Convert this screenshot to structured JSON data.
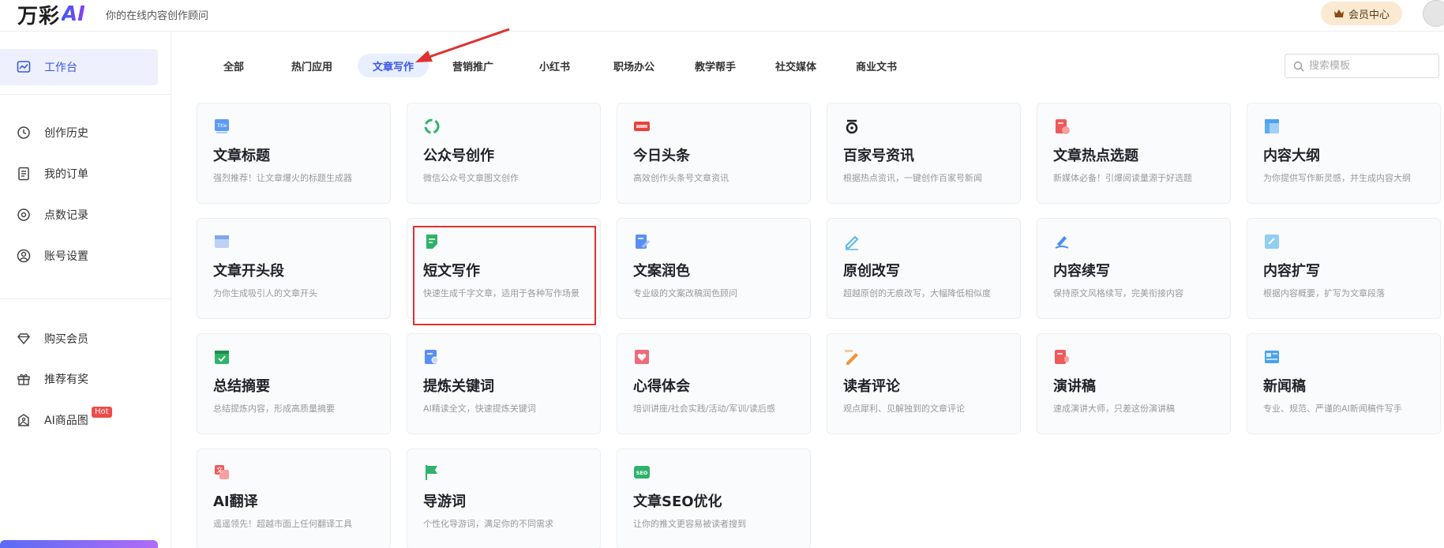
{
  "header": {
    "logo_text": "万彩",
    "logo_ai": "AI",
    "slogan": "你的在线内容创作顾问",
    "vip_label": "会员中心"
  },
  "sidebar": {
    "items": [
      {
        "label": "工作台",
        "icon": "dashboard-icon",
        "active": true
      },
      {
        "label": "创作历史",
        "icon": "history-icon"
      },
      {
        "label": "我的订单",
        "icon": "order-icon"
      },
      {
        "label": "点数记录",
        "icon": "points-icon"
      },
      {
        "label": "账号设置",
        "icon": "user-icon"
      },
      {
        "label": "购买会员",
        "icon": "diamond-icon"
      },
      {
        "label": "推荐有奖",
        "icon": "gift-icon"
      },
      {
        "label": "AI商品图",
        "icon": "image-icon",
        "badge": "Hot"
      }
    ]
  },
  "tabs": [
    "全部",
    "热门应用",
    "文章写作",
    "营销推广",
    "小红书",
    "职场办公",
    "教学帮手",
    "社交媒体",
    "商业文书"
  ],
  "active_tab": "文章写作",
  "search": {
    "placeholder": "搜索模板"
  },
  "cards": [
    {
      "title": "文章标题",
      "desc": "强烈推荐！让文章爆火的标题生成器",
      "icon": "title-icon",
      "color": "#5b9bf5"
    },
    {
      "title": "公众号创作",
      "desc": "微信公众号文章图文创作",
      "icon": "recycle-icon",
      "color": "#2fb36a"
    },
    {
      "title": "今日头条",
      "desc": "高效创作头条号文章资讯",
      "icon": "toutiao-icon",
      "color": "#e8423c"
    },
    {
      "title": "百家号资讯",
      "desc": "根据热点资讯，一键创作百家号新闻",
      "icon": "baijia-icon",
      "color": "#222222"
    },
    {
      "title": "文章热点选题",
      "desc": "新媒体必备！引爆阅读量源于好选题",
      "icon": "hot-topic-icon",
      "color": "#ef5a5a"
    },
    {
      "title": "内容大纲",
      "desc": "为你提供写作新灵感，并生成内容大纲",
      "icon": "outline-icon",
      "color": "#4aa3f0"
    },
    {
      "title": "文章开头段",
      "desc": "为你生成吸引人的文章开头",
      "icon": "opening-icon",
      "color": "#7fa8f2"
    },
    {
      "title": "短文写作",
      "desc": "快速生成千字文章，适用于各种写作场景",
      "icon": "short-writing-icon",
      "color": "#2fb36a"
    },
    {
      "title": "文案润色",
      "desc": "专业级的文案改稿润色顾问",
      "icon": "polish-icon",
      "color": "#5b8ef5"
    },
    {
      "title": "原创改写",
      "desc": "超越原创的无痕改写，大幅降低相似度",
      "icon": "rewrite-icon",
      "color": "#58b8e8"
    },
    {
      "title": "内容续写",
      "desc": "保持原文风格续写，完美衔接内容",
      "icon": "continue-icon",
      "color": "#4a8ef0"
    },
    {
      "title": "内容扩写",
      "desc": "根据内容概要，扩写为文章段落",
      "icon": "expand-icon",
      "color": "#4ab0ec"
    },
    {
      "title": "总结摘要",
      "desc": "总结提炼内容，形成高质量摘要",
      "icon": "summary-icon",
      "color": "#2fb36a"
    },
    {
      "title": "提炼关键词",
      "desc": "AI精读全文，快速提炼关键词",
      "icon": "keyword-icon",
      "color": "#5b8ef5"
    },
    {
      "title": "心得体会",
      "desc": "培训讲座/社会实践/活动/军训/读后感",
      "icon": "heart-icon",
      "color": "#ef5a6a"
    },
    {
      "title": "读者评论",
      "desc": "观点犀利、见解独到的文章评论",
      "icon": "comment-icon",
      "color": "#f0953a"
    },
    {
      "title": "演讲稿",
      "desc": "速成演讲大师，只差这份演讲稿",
      "icon": "speech-icon",
      "color": "#ef5a5a"
    },
    {
      "title": "新闻稿",
      "desc": "专业、规范、严谨的AI新闻稿件写手",
      "icon": "news-icon",
      "color": "#4aa3f0"
    },
    {
      "title": "AI翻译",
      "desc": "遥遥领先！超越市面上任何翻译工具",
      "icon": "translate-icon",
      "color": "#ef5a5a"
    },
    {
      "title": "导游词",
      "desc": "个性化导游词，满足你的不同需求",
      "icon": "flag-icon",
      "color": "#2fb36a"
    },
    {
      "title": "文章SEO优化",
      "desc": "让你的推文更容易被读者搜到",
      "icon": "seo-icon",
      "color": "#2fb36a"
    }
  ],
  "highlighted_card": "短文写作",
  "colors": {
    "accent": "#3a57e8",
    "annotation": "#e03131"
  }
}
